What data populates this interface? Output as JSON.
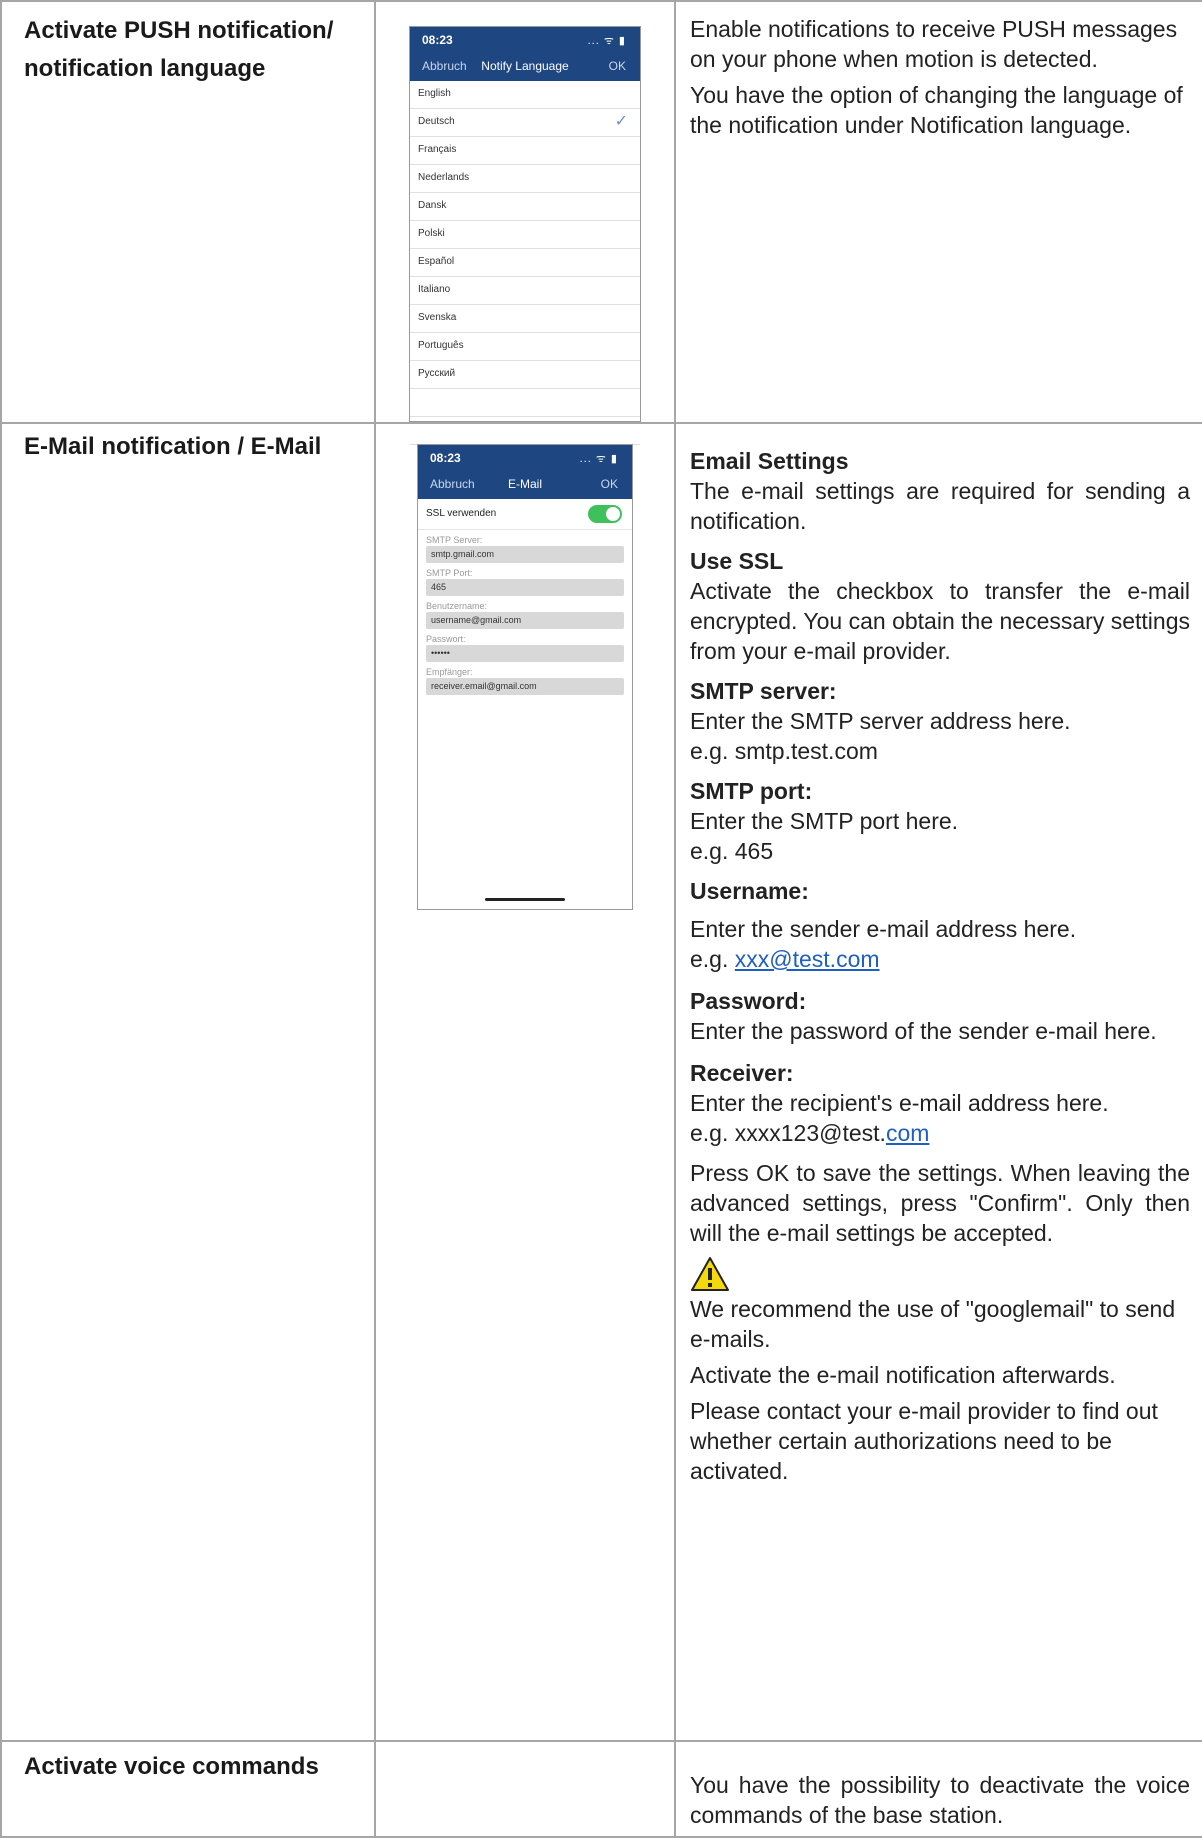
{
  "rows": [
    {
      "label": "Activate PUSH notification/ notification language",
      "description": [
        "Enable notifications to receive PUSH messages on your phone when motion is detected.",
        "You have the option of changing the language of the notification under Notification language."
      ],
      "phone": {
        "time": "08:23",
        "status": "... ᯤ ▮",
        "nav_left": "Abbruch",
        "nav_title": "Notify Language",
        "nav_right": "OK",
        "languages": [
          "English",
          "Deutsch",
          "Français",
          "Nederlands",
          "Dansk",
          "Polski",
          "Español",
          "Italiano",
          "Svenska",
          "Português",
          "Русский"
        ],
        "selected_language": "Deutsch",
        "check_glyph": "✓"
      }
    },
    {
      "label": "E-Mail notification / E-Mail",
      "phone": {
        "time": "08:23",
        "status": "... ᯤ ▮",
        "nav_left": "Abbruch",
        "nav_title": "E-Mail",
        "nav_right": "OK",
        "ssl_label": "SSL verwenden",
        "ssl_enabled": true,
        "fields": [
          {
            "label": "SMTP Server:",
            "value": "smtp.gmail.com"
          },
          {
            "label": "SMTP Port:",
            "value": "465"
          },
          {
            "label": "Benutzername:",
            "value": "username@gmail.com"
          },
          {
            "label": "Passwort:",
            "value": "••••••"
          },
          {
            "label": "Empfänger:",
            "value": "receiver.email@gmail.com"
          }
        ]
      },
      "sections": {
        "email_settings_heading": "Email Settings",
        "email_settings_text": "The e-mail settings are required for sending a notification.",
        "ssl_heading": "Use SSL",
        "ssl_text": "Activate the checkbox to transfer the e-mail encrypted. You can obtain the necessary settings from your e-mail provider.",
        "smtp_server_heading": "SMTP server:",
        "smtp_server_text": "Enter the SMTP server address here.",
        "smtp_server_example": "e.g. smtp.test.com",
        "smtp_port_heading": "SMTP port:",
        "smtp_port_text": "Enter the SMTP port here.",
        "smtp_port_example": "e.g. 465",
        "username_heading": "Username:",
        "username_text": "Enter the sender e-mail address here.",
        "username_example_prefix": "e.g. ",
        "username_example_link": "xxx@test.com",
        "password_heading": "Password:",
        "password_text": "Enter the password of the sender e-mail here.",
        "receiver_heading": "Receiver:",
        "receiver_text": "Enter the recipient's e-mail address here.",
        "receiver_example_prefix": "e.g. xxxx123@test.",
        "receiver_example_link": "com",
        "save_text": "Press OK to save the settings. When leaving the advanced settings, press \"Confirm\". Only then will the e-mail settings be accepted.",
        "warning_icon": "warning-icon",
        "recommend_text": "We recommend the use of \"googlemail\" to send e-mails.",
        "activate_text": "Activate the e-mail notification afterwards.",
        "contact_text": "Please contact your e-mail provider to find out whether certain authorizations need to be activated."
      }
    },
    {
      "label": "Activate voice commands",
      "description": "You have the possibility to deactivate the voice commands of the base station."
    }
  ],
  "colors": {
    "phone_header": "#1e4681",
    "toggle_on": "#3ec05a",
    "link": "#1f5fbf",
    "border": "#a6a6a6",
    "warning_fill": "#f5d90a"
  }
}
